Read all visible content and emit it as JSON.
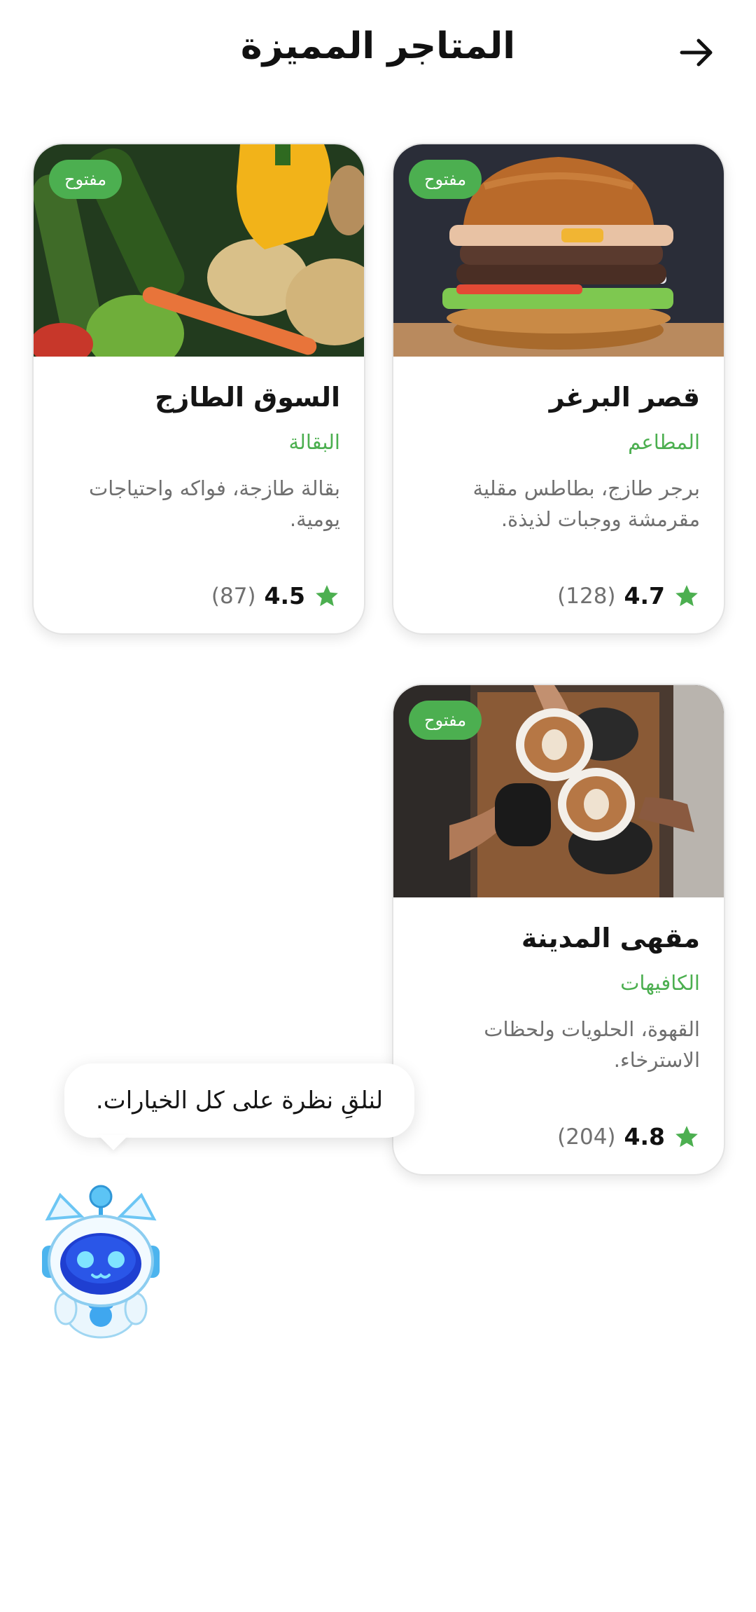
{
  "header": {
    "title": "المتاجر المميزة",
    "back_icon": "arrow-right-icon"
  },
  "colors": {
    "accent": "#4caf50",
    "text_primary": "#151515",
    "text_secondary": "#6f6f6f"
  },
  "stores": [
    {
      "name": "قصر البرغر",
      "category": "المطاعم",
      "description": "برجر طازج، بطاطس مقلية مقرمشة ووجبات لذيذة.",
      "status": "مفتوح",
      "rating": "4.7",
      "reviews": "(128)",
      "image": "burger-photo"
    },
    {
      "name": "السوق الطازج",
      "category": "البقالة",
      "description": "بقالة طازجة، فواكه واحتياجات يومية.",
      "status": "مفتوح",
      "rating": "4.5",
      "reviews": "(87)",
      "image": "vegetables-photo"
    },
    {
      "name": "مقهى المدينة",
      "category": "الكافيهات",
      "description": "القهوة، الحلويات ولحظات الاسترخاء.",
      "status": "مفتوح",
      "rating": "4.8",
      "reviews": "(204)",
      "image": "coffee-photo"
    }
  ],
  "assistant": {
    "message": "لنلقِ نظرة على كل الخيارات.",
    "icon": "robot-mascot-icon"
  }
}
